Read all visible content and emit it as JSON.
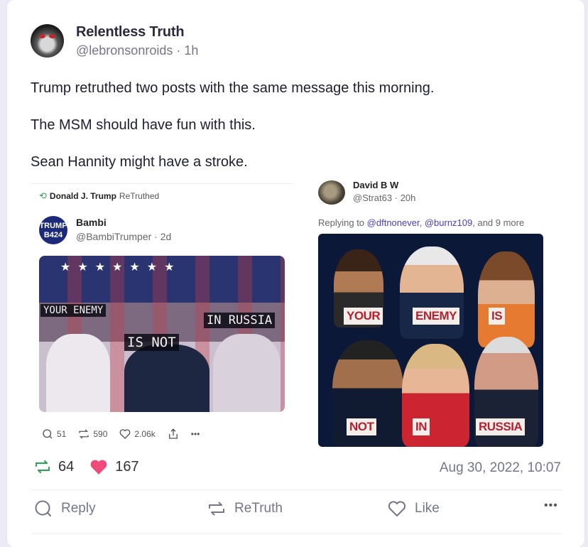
{
  "post": {
    "display_name": "Relentless Truth",
    "handle": "@lebronsonroids",
    "time": "1h",
    "paragraphs": [
      "Trump retruthed two posts with the same message this morning.",
      "The MSM should have fun with this.",
      "Sean Hannity might have a stroke."
    ],
    "retruth_count": "64",
    "like_count": "167",
    "timestamp": "Aug 30, 2022, 10:07"
  },
  "embed_left": {
    "retruth_by": "Donald J. Trump",
    "retruth_label": "ReTruthed",
    "author_name": "Bambi",
    "author_handle": "@BambiTrumper",
    "author_time": "2d",
    "avatar_text_1": "TRUMP",
    "avatar_text_2": "B424",
    "caption_1": "YOUR ENEMY",
    "caption_2": "IS NOT",
    "caption_3": "IN RUSSIA",
    "replies": "51",
    "retruths": "590",
    "likes": "2.06k"
  },
  "embed_right": {
    "author_name": "David B W",
    "author_handle": "@Strat63",
    "author_time": "20h",
    "replying_prefix": "Replying to",
    "mention_1": "@dftnonever",
    "mention_2": "@burnz109",
    "replying_suffix": ", and 9 more",
    "tags": [
      "YOUR",
      "ENEMY",
      "IS",
      "NOT",
      "IN",
      "RUSSIA"
    ]
  },
  "actions": {
    "reply": "Reply",
    "retruth": "ReTruth",
    "like": "Like",
    "more": "•••"
  },
  "colors": {
    "retruth_green": "#3a9d5d",
    "like_pink": "#ee4b7b",
    "mention_purple": "#4b3cc7"
  }
}
